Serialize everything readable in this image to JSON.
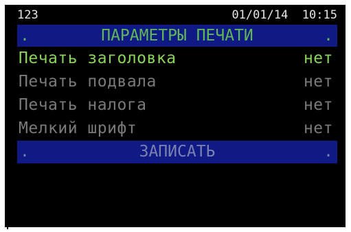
{
  "status": {
    "left": "123",
    "date": "01/01/14",
    "time": "10:15"
  },
  "title_bar": {
    "dot_left": ".",
    "title": "ПАРАМЕТРЫ ПЕЧАТИ",
    "dot_right": "."
  },
  "menu": [
    {
      "label": "Печать заголовка",
      "value": "нет",
      "selected": true
    },
    {
      "label": "Печать подвала",
      "value": "нет",
      "selected": false
    },
    {
      "label": "Печать налога",
      "value": "нет",
      "selected": false
    },
    {
      "label": "Мелкий шрифт",
      "value": "нет",
      "selected": false
    }
  ],
  "save_bar": {
    "dot_left": ".",
    "label": "ЗАПИСАТЬ",
    "dot_right": "."
  },
  "colors": {
    "background": "#000000",
    "bar": "#0f1a85",
    "selected_text": "#8bd45a",
    "title_text": "#61b657",
    "inactive_text": "#7a7a7a"
  }
}
